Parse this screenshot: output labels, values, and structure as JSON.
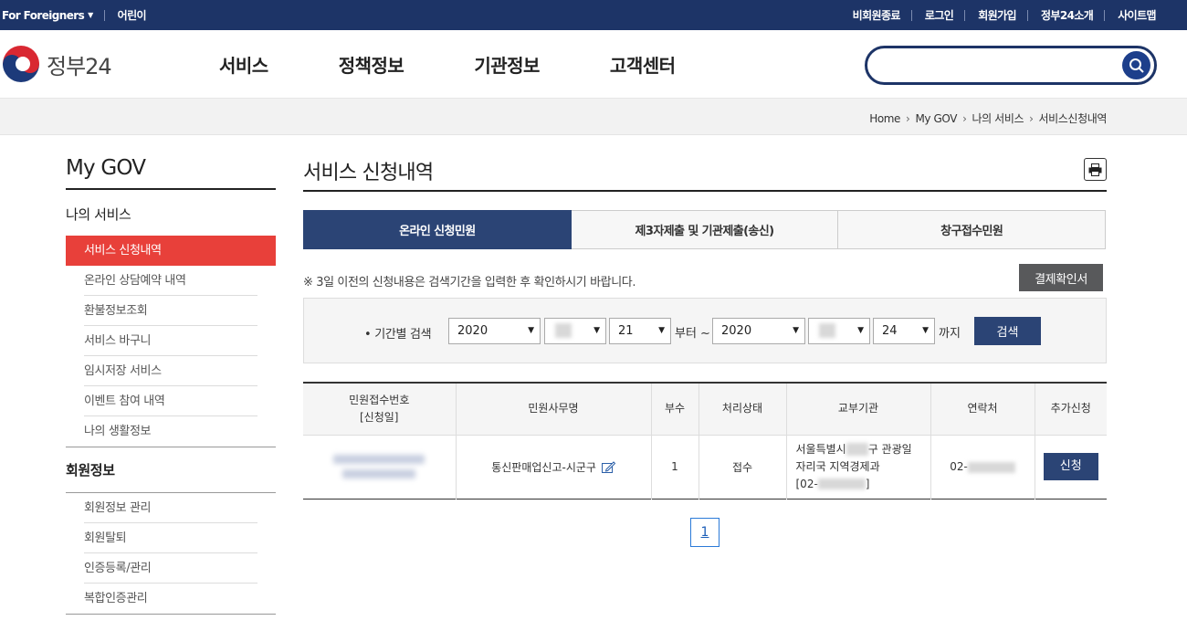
{
  "topbar": {
    "foreigners": "For Foreigners",
    "kids": "어린이",
    "links": [
      "비회원종료",
      "로그인",
      "회원가입",
      "정부24소개",
      "사이트맵"
    ]
  },
  "header": {
    "logo_text": "정부24",
    "nav": [
      "서비스",
      "정책정보",
      "기관정보",
      "고객센터"
    ],
    "search_value": ""
  },
  "breadcrumb": [
    "Home",
    "My GOV",
    "나의 서비스",
    "서비스신청내역"
  ],
  "sidebar": {
    "title": "My GOV",
    "section1": "나의 서비스",
    "items1": [
      "서비스 신청내역",
      "온라인 상담예약 내역",
      "환불정보조회",
      "서비스 바구니",
      "임시저장 서비스",
      "이벤트 참여 내역",
      "나의 생활정보"
    ],
    "section2": "회원정보",
    "items2": [
      "회원정보 관리",
      "회원탈퇴",
      "인증등록/관리",
      "복합인증관리"
    ]
  },
  "main": {
    "title": "서비스 신청내역",
    "tabs": [
      "온라인 신청민원",
      "제3자제출 및 기관제출(송신)",
      "창구접수민원"
    ],
    "notice": "※ 3일 이전의 신청내용은 검색기간을 입력한 후 확인하시기 바랍니다.",
    "pay_button": "결제확인서",
    "period_label": "• 기간별 검색",
    "from_year": "2020",
    "from_day": "21",
    "from_text": "부터 ~",
    "to_year": "2020",
    "to_day": "24",
    "to_text": "까지",
    "search_button": "검색",
    "table_headers": [
      "민원접수번호\n[신청일]",
      "민원사무명",
      "부수",
      "처리상태",
      "교부기관",
      "연락처",
      "추가신청"
    ],
    "row": {
      "service": "통신판매업신고-시군구",
      "copies": "1",
      "status": "접수",
      "agency_1": "서울특별시",
      "agency_2": "구 관광일",
      "agency_3": "자리국 지역경제과",
      "agency_4": "[02-",
      "agency_5": "]",
      "contact": "02-",
      "apply": "신청"
    },
    "page": "1"
  },
  "colors": {
    "navy": "#1d3467",
    "tab_active": "#2b4475",
    "menu_active": "#e8403a"
  },
  "icons": [
    "search-icon",
    "print-icon",
    "edit-icon",
    "chevron-down-icon",
    "chevron-right-icon"
  ]
}
